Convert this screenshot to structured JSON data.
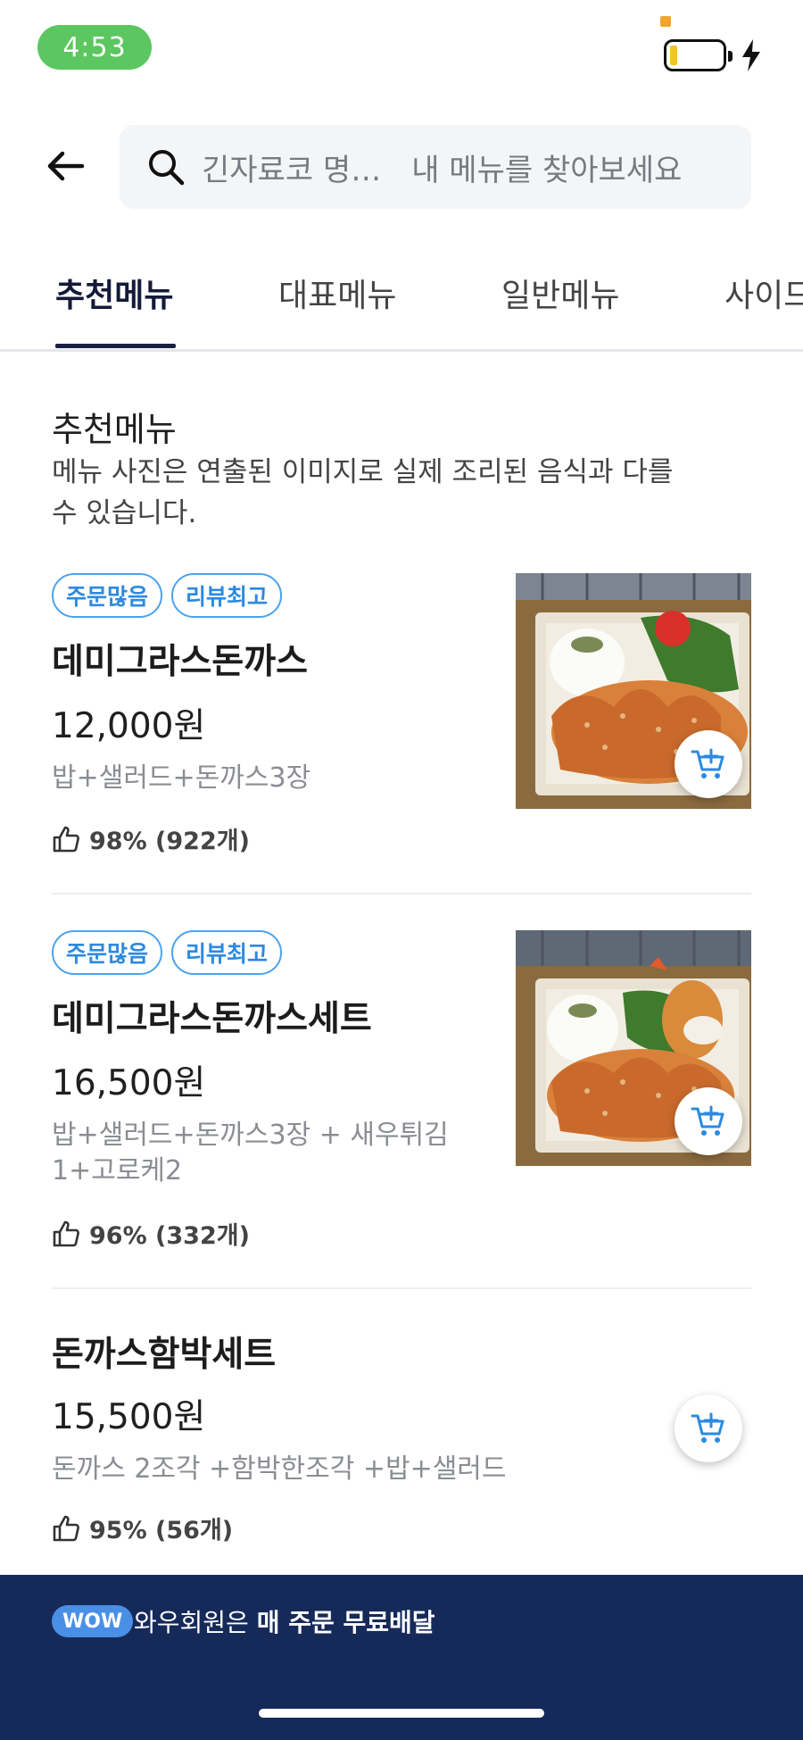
{
  "status_bar": {
    "time": "4:53"
  },
  "header": {
    "search_query": "긴자료코 명…",
    "search_placeholder": "내 메뉴를 찾아보세요"
  },
  "tabs": [
    "추천메뉴",
    "대표메뉴",
    "일반메뉴",
    "사이드"
  ],
  "section": {
    "title": "추천메뉴",
    "description": "메뉴 사진은 연출된 이미지로 실제 조리된 음식과 다를 수 있습니다."
  },
  "items": [
    {
      "badges": [
        "주문많음",
        "리뷰최고"
      ],
      "name": "데미그라스돈까스",
      "price": "12,000원",
      "desc": "밥+샐러드+돈까스3장",
      "rating": "98% (922개)"
    },
    {
      "badges": [
        "주문많음",
        "리뷰최고"
      ],
      "name": "데미그라스돈까스세트",
      "price": "16,500원",
      "desc": "밥+샐러드+돈까스3장 + 새우튀김1+고로케2",
      "rating": "96% (332개)"
    },
    {
      "badges": [],
      "name": "돈까스함박세트",
      "price": "15,500원",
      "desc": "돈까스 2조각 +함박한조각 +밥+샐러드",
      "rating": "95% (56개)"
    }
  ],
  "footer": {
    "badge": "WOW",
    "text_plain": "와우회원은 ",
    "text_bold": "매 주문 무료배달"
  },
  "colors": {
    "accent": "#4aa3ef",
    "navy": "#162a5a",
    "status_green": "#5cc760"
  }
}
